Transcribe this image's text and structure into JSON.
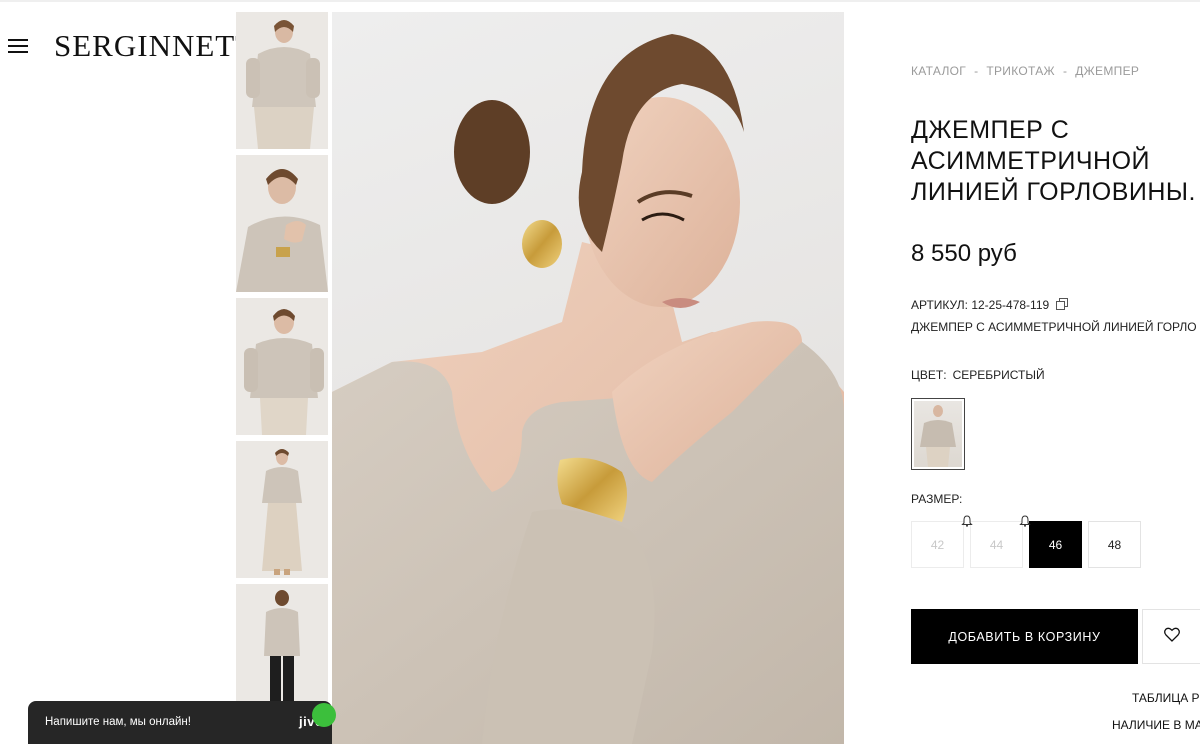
{
  "header": {
    "logo": "SERGINNETTI"
  },
  "breadcrumb": {
    "items": [
      "КАТАЛОГ",
      "ТРИКОТАЖ",
      "ДЖЕМПЕР"
    ],
    "separator": "-"
  },
  "product": {
    "title_lines": [
      "ДЖЕМПЕР С",
      "АСИММЕТРИЧНОЙ",
      "ЛИНИЕЙ ГОРЛОВИНЫ."
    ],
    "price": "8 550 руб",
    "sku_label": "АРТИКУЛ:",
    "sku_value": "12-25-478-119",
    "subname": "ДЖЕМПЕР С АСИММЕТРИЧНОЙ ЛИНИЕЙ ГОРЛО",
    "color_label": "ЦВЕТ:",
    "color_value": "СЕРЕБРИСТЫЙ",
    "size_label": "РАЗМЕР:",
    "sizes": [
      {
        "label": "42",
        "available": false,
        "notify": false,
        "selected": false
      },
      {
        "label": "44",
        "available": false,
        "notify": true,
        "selected": false
      },
      {
        "label": "46",
        "available": true,
        "notify": true,
        "selected": true
      },
      {
        "label": "48",
        "available": true,
        "notify": false,
        "selected": false
      }
    ],
    "add_to_cart": "ДОБАВИТЬ В КОРЗИНУ",
    "size_table_link": "ТАБЛИЦА Р",
    "stock_link": "НАЛИЧИЕ В МА"
  },
  "chat": {
    "text": "Напишите нам, мы онлайн!",
    "logo": "jivo",
    "status_color": "#3cbf3c"
  },
  "colors": {
    "accent": "#000000",
    "muted": "#9a9a9a"
  },
  "icons": [
    "menu-icon",
    "copy-icon",
    "bell-icon",
    "heart-icon"
  ]
}
